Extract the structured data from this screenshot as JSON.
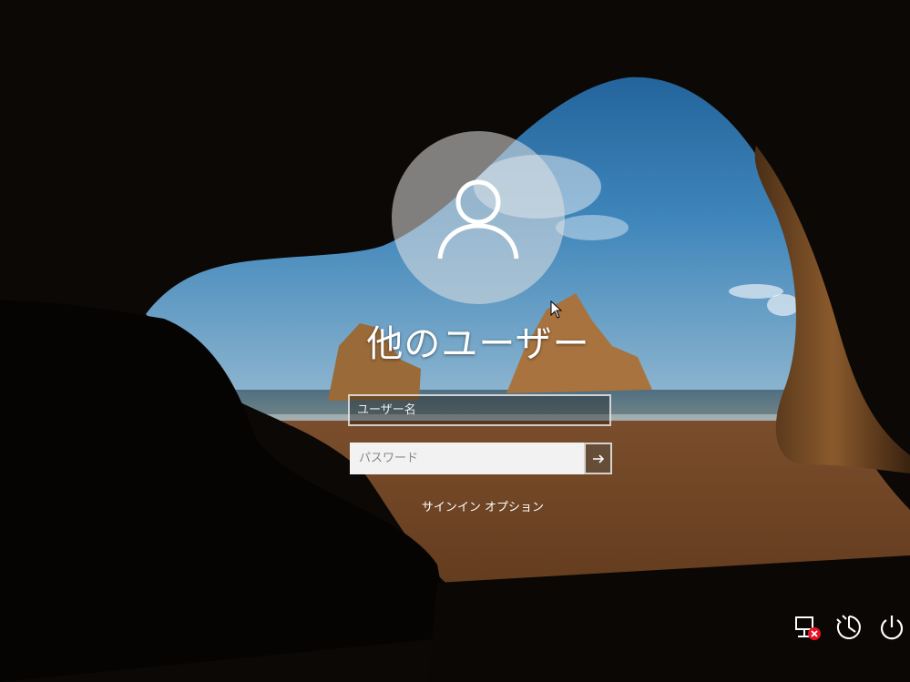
{
  "login": {
    "user_name": "他のユーザー",
    "username_placeholder": "ユーザー名",
    "password_placeholder": "パスワード",
    "signin_options": "サインイン オプション"
  },
  "icons": {
    "avatar": "person-icon",
    "submit": "arrow-right-icon",
    "network": "network-disconnected-icon",
    "accessibility": "ease-of-access-icon",
    "power": "power-icon"
  },
  "colors": {
    "text": "#ffffff",
    "password_bg": "#f2f2f2",
    "error_badge": "#e81123"
  }
}
